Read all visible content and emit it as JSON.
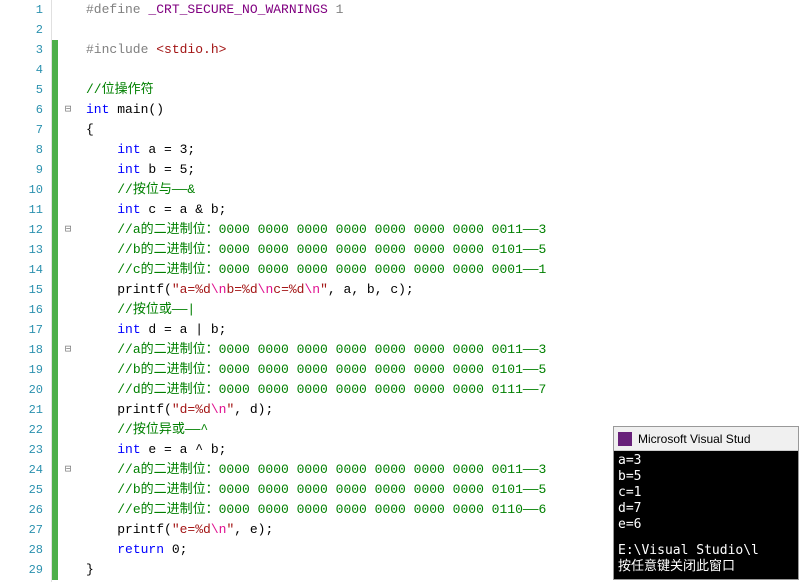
{
  "lines": [
    {
      "n": 1,
      "marker": "",
      "fold": "",
      "segs": [
        {
          "c": "c-grey",
          "t": "#define "
        },
        {
          "c": "c-purple",
          "t": "_CRT_SECURE_NO_WARNINGS"
        },
        {
          "c": "c-grey",
          "t": " 1"
        }
      ]
    },
    {
      "n": 2,
      "marker": "",
      "fold": "",
      "segs": []
    },
    {
      "n": 3,
      "marker": "green",
      "fold": "",
      "segs": [
        {
          "c": "c-grey",
          "t": "#include "
        },
        {
          "c": "c-red",
          "t": "<stdio.h>"
        }
      ]
    },
    {
      "n": 4,
      "marker": "green",
      "fold": "",
      "segs": []
    },
    {
      "n": 5,
      "marker": "green",
      "fold": "",
      "segs": [
        {
          "c": "c-green",
          "t": "//位操作符"
        }
      ]
    },
    {
      "n": 6,
      "marker": "green",
      "fold": "box",
      "segs": [
        {
          "c": "c-blue",
          "t": "int"
        },
        {
          "c": "c-black",
          "t": " main()"
        }
      ]
    },
    {
      "n": 7,
      "marker": "green",
      "fold": "",
      "segs": [
        {
          "c": "c-black",
          "t": "{"
        }
      ]
    },
    {
      "n": 8,
      "marker": "green",
      "fold": "",
      "segs": [
        {
          "c": "c-black",
          "t": "    "
        },
        {
          "c": "c-blue",
          "t": "int"
        },
        {
          "c": "c-black",
          "t": " a = 3;"
        }
      ]
    },
    {
      "n": 9,
      "marker": "green",
      "fold": "",
      "segs": [
        {
          "c": "c-black",
          "t": "    "
        },
        {
          "c": "c-blue",
          "t": "int"
        },
        {
          "c": "c-black",
          "t": " b = 5;"
        }
      ]
    },
    {
      "n": 10,
      "marker": "green",
      "fold": "",
      "segs": [
        {
          "c": "c-black",
          "t": "    "
        },
        {
          "c": "c-green",
          "t": "//按位与——&"
        }
      ]
    },
    {
      "n": 11,
      "marker": "green",
      "fold": "",
      "segs": [
        {
          "c": "c-black",
          "t": "    "
        },
        {
          "c": "c-blue",
          "t": "int"
        },
        {
          "c": "c-black",
          "t": " c = a & b;"
        }
      ]
    },
    {
      "n": 12,
      "marker": "green",
      "fold": "box",
      "segs": [
        {
          "c": "c-black",
          "t": "    "
        },
        {
          "c": "c-green",
          "t": "//a的二进制位：0000 0000 0000 0000 0000 0000 0000 0011——3"
        }
      ]
    },
    {
      "n": 13,
      "marker": "green",
      "fold": "",
      "segs": [
        {
          "c": "c-black",
          "t": "    "
        },
        {
          "c": "c-green",
          "t": "//b的二进制位：0000 0000 0000 0000 0000 0000 0000 0101——5"
        }
      ]
    },
    {
      "n": 14,
      "marker": "green",
      "fold": "",
      "segs": [
        {
          "c": "c-black",
          "t": "    "
        },
        {
          "c": "c-green",
          "t": "//c的二进制位：0000 0000 0000 0000 0000 0000 0000 0001——1"
        }
      ]
    },
    {
      "n": 15,
      "marker": "green",
      "fold": "",
      "segs": [
        {
          "c": "c-black",
          "t": "    printf("
        },
        {
          "c": "c-red",
          "t": "\"a=%d"
        },
        {
          "c": "c-pink",
          "t": "\\n"
        },
        {
          "c": "c-red",
          "t": "b=%d"
        },
        {
          "c": "c-pink",
          "t": "\\n"
        },
        {
          "c": "c-red",
          "t": "c=%d"
        },
        {
          "c": "c-pink",
          "t": "\\n"
        },
        {
          "c": "c-red",
          "t": "\""
        },
        {
          "c": "c-black",
          "t": ", a, b, c);"
        }
      ]
    },
    {
      "n": 16,
      "marker": "green",
      "fold": "",
      "segs": [
        {
          "c": "c-black",
          "t": "    "
        },
        {
          "c": "c-green",
          "t": "//按位或——|"
        }
      ]
    },
    {
      "n": 17,
      "marker": "green",
      "fold": "",
      "segs": [
        {
          "c": "c-black",
          "t": "    "
        },
        {
          "c": "c-blue",
          "t": "int"
        },
        {
          "c": "c-black",
          "t": " d = a | b;"
        }
      ]
    },
    {
      "n": 18,
      "marker": "green",
      "fold": "box",
      "segs": [
        {
          "c": "c-black",
          "t": "    "
        },
        {
          "c": "c-green",
          "t": "//a的二进制位：0000 0000 0000 0000 0000 0000 0000 0011——3"
        }
      ]
    },
    {
      "n": 19,
      "marker": "green",
      "fold": "",
      "segs": [
        {
          "c": "c-black",
          "t": "    "
        },
        {
          "c": "c-green",
          "t": "//b的二进制位：0000 0000 0000 0000 0000 0000 0000 0101——5"
        }
      ]
    },
    {
      "n": 20,
      "marker": "green",
      "fold": "",
      "segs": [
        {
          "c": "c-black",
          "t": "    "
        },
        {
          "c": "c-green",
          "t": "//d的二进制位：0000 0000 0000 0000 0000 0000 0000 0111——7"
        }
      ]
    },
    {
      "n": 21,
      "marker": "green",
      "fold": "",
      "segs": [
        {
          "c": "c-black",
          "t": "    printf("
        },
        {
          "c": "c-red",
          "t": "\"d=%d"
        },
        {
          "c": "c-pink",
          "t": "\\n"
        },
        {
          "c": "c-red",
          "t": "\""
        },
        {
          "c": "c-black",
          "t": ", d);"
        }
      ]
    },
    {
      "n": 22,
      "marker": "green",
      "fold": "",
      "segs": [
        {
          "c": "c-black",
          "t": "    "
        },
        {
          "c": "c-green",
          "t": "//按位异或——^"
        }
      ]
    },
    {
      "n": 23,
      "marker": "green",
      "fold": "",
      "segs": [
        {
          "c": "c-black",
          "t": "    "
        },
        {
          "c": "c-blue",
          "t": "int"
        },
        {
          "c": "c-black",
          "t": " e = a ^ b;"
        }
      ]
    },
    {
      "n": 24,
      "marker": "green",
      "fold": "box",
      "segs": [
        {
          "c": "c-black",
          "t": "    "
        },
        {
          "c": "c-green",
          "t": "//a的二进制位：0000 0000 0000 0000 0000 0000 0000 0011——3"
        }
      ]
    },
    {
      "n": 25,
      "marker": "green",
      "fold": "",
      "segs": [
        {
          "c": "c-black",
          "t": "    "
        },
        {
          "c": "c-green",
          "t": "//b的二进制位：0000 0000 0000 0000 0000 0000 0000 0101——5"
        }
      ]
    },
    {
      "n": 26,
      "marker": "green",
      "fold": "",
      "segs": [
        {
          "c": "c-black",
          "t": "    "
        },
        {
          "c": "c-green",
          "t": "//e的二进制位：0000 0000 0000 0000 0000 0000 0000 0110——6"
        }
      ]
    },
    {
      "n": 27,
      "marker": "green",
      "fold": "",
      "segs": [
        {
          "c": "c-black",
          "t": "    printf("
        },
        {
          "c": "c-red",
          "t": "\"e=%d"
        },
        {
          "c": "c-pink",
          "t": "\\n"
        },
        {
          "c": "c-red",
          "t": "\""
        },
        {
          "c": "c-black",
          "t": ", e);"
        }
      ]
    },
    {
      "n": 28,
      "marker": "green",
      "fold": "",
      "segs": [
        {
          "c": "c-black",
          "t": "    "
        },
        {
          "c": "c-blue",
          "t": "return"
        },
        {
          "c": "c-black",
          "t": " 0;"
        }
      ]
    },
    {
      "n": 29,
      "marker": "green",
      "fold": "",
      "segs": [
        {
          "c": "c-black",
          "t": "}"
        }
      ]
    }
  ],
  "console": {
    "title": "Microsoft Visual Stud",
    "output": [
      "a=3",
      "b=5",
      "c=1",
      "d=7",
      "e=6"
    ],
    "path": "E:\\Visual Studio\\l",
    "prompt": "按任意键关闭此窗口"
  }
}
